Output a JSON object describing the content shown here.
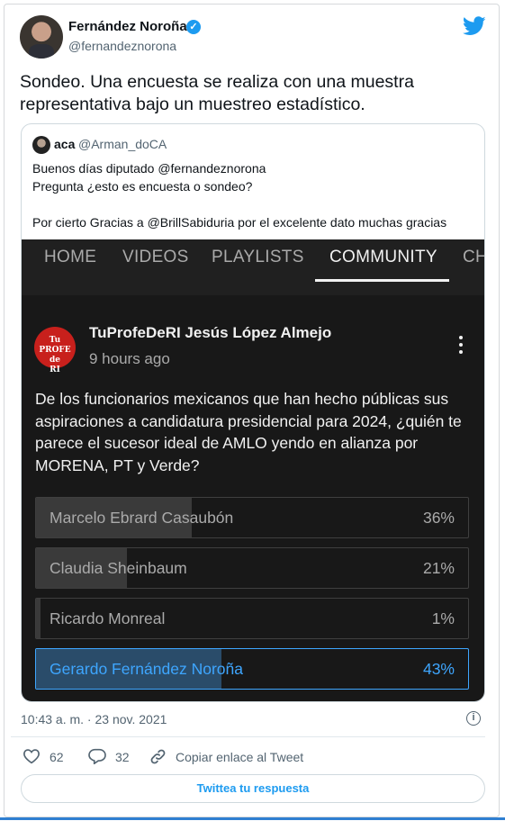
{
  "author": {
    "name": "Fernández Noroña",
    "handle": "@fernandeznorona",
    "verified": true
  },
  "tweet": {
    "text": "Sondeo. Una encuesta se realiza con una muestra representativa bajo un muestreo estadístico.",
    "timestamp": "10:43 a. m. · 23 nov. 2021"
  },
  "quoted": {
    "name": "aca",
    "handle": "@Arman_doCA",
    "lines": [
      "Buenos días diputado @fernandeznorona",
      "Pregunta ¿esto es encuesta o sondeo?",
      "",
      "Por cierto Gracias a @BrillSabiduria por el excelente dato muchas gracias"
    ]
  },
  "youtube": {
    "tabs": [
      "HOME",
      "VIDEOS",
      "PLAYLISTS",
      "COMMUNITY",
      "CH"
    ],
    "active_tab": "COMMUNITY",
    "channel_avatar_text": "Tu PROFE de RI",
    "post_author": "TuProfeDeRI Jesús López Almejo",
    "post_time": "9 hours ago",
    "question": "De los funcionarios mexicanos que han hecho públicas sus aspiraciones a candidatura presidencial para 2024, ¿quién te parece el sucesor ideal de AMLO yendo en alianza por MORENA, PT y Verde?",
    "poll": [
      {
        "label": "Marcelo Ebrard Casaubón",
        "percent": "36%",
        "value": 36
      },
      {
        "label": "Claudia Sheinbaum",
        "percent": "21%",
        "value": 21
      },
      {
        "label": "Ricardo Monreal",
        "percent": "1%",
        "value": 1
      },
      {
        "label": "Gerardo Fernández Noroña",
        "percent": "43%",
        "value": 43
      }
    ]
  },
  "actions": {
    "likes": "62",
    "replies": "32",
    "copy_link": "Copiar enlace al Tweet",
    "reply_button": "Twittea tu respuesta"
  },
  "colors": {
    "twitter_blue": "#1d9bf0",
    "yt_accent": "#3ea6ff"
  }
}
